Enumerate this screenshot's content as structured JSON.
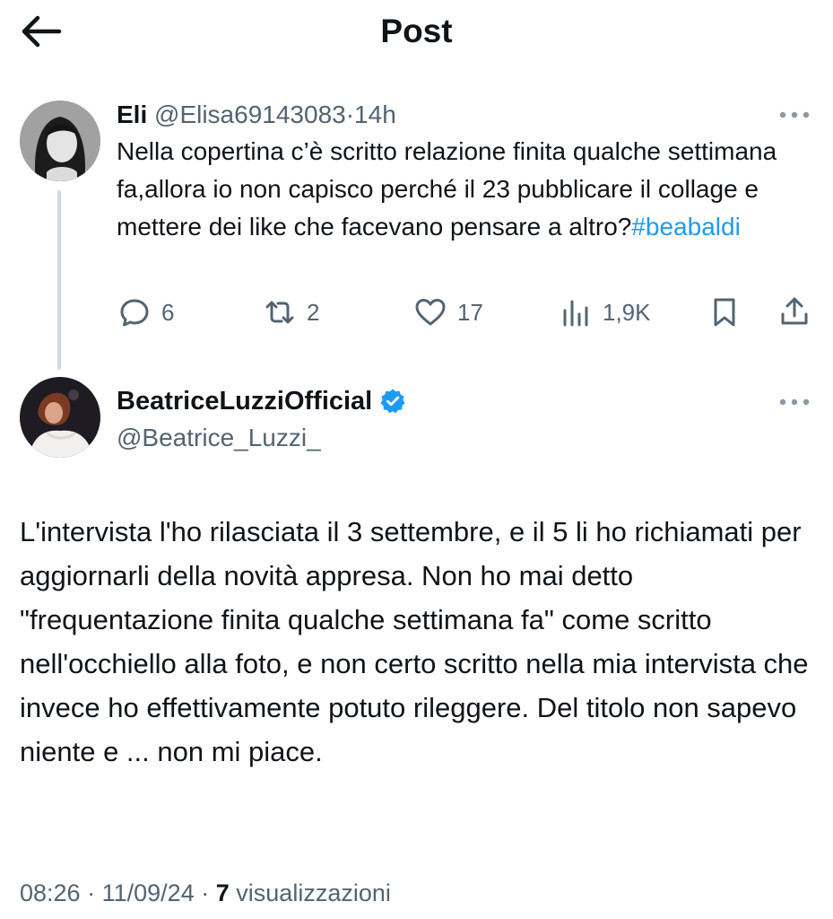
{
  "header": {
    "title": "Post"
  },
  "parent_tweet": {
    "name": "Eli",
    "handle": "@Elisa69143083",
    "separator": "·",
    "time": "14h",
    "text": "Nella copertina c’è scritto relazione finita qualche settimana fa,allora io non capisco perché il 23 pubblicare il collage e mettere dei like che facevano pensare a altro?",
    "hashtag": "#beabaldi",
    "replies": "6",
    "reposts": "2",
    "likes": "17",
    "views": "1,9K"
  },
  "main_tweet": {
    "name": "BeatriceLuzziOfficial",
    "handle": "@Beatrice_Luzzi_",
    "text": "L'intervista l'ho rilasciata il 3 settembre, e il 5 li ho richiamati per aggiornarli della novità appresa. Non ho mai detto \"frequentazione finita qualche settimana fa\" come scritto nell'occhiello alla foto, e non certo scritto nella mia intervista che invece ho effettivamente potuto rileggere. Del titolo non sapevo niente e ... non mi piace.",
    "meta": {
      "time": "08:26",
      "sep1": "·",
      "date": "11/09/24",
      "sep2": "·",
      "views_count": "7",
      "views_label": "visualizzazioni"
    }
  },
  "colors": {
    "accent": "#1d9bf0",
    "muted": "#536471",
    "text": "#0f1419",
    "thread_line": "#cfd9de"
  },
  "icons": [
    "back-arrow-icon",
    "more-icon",
    "reply-icon",
    "repost-icon",
    "like-icon",
    "views-icon",
    "bookmark-icon",
    "share-icon",
    "verified-icon"
  ]
}
